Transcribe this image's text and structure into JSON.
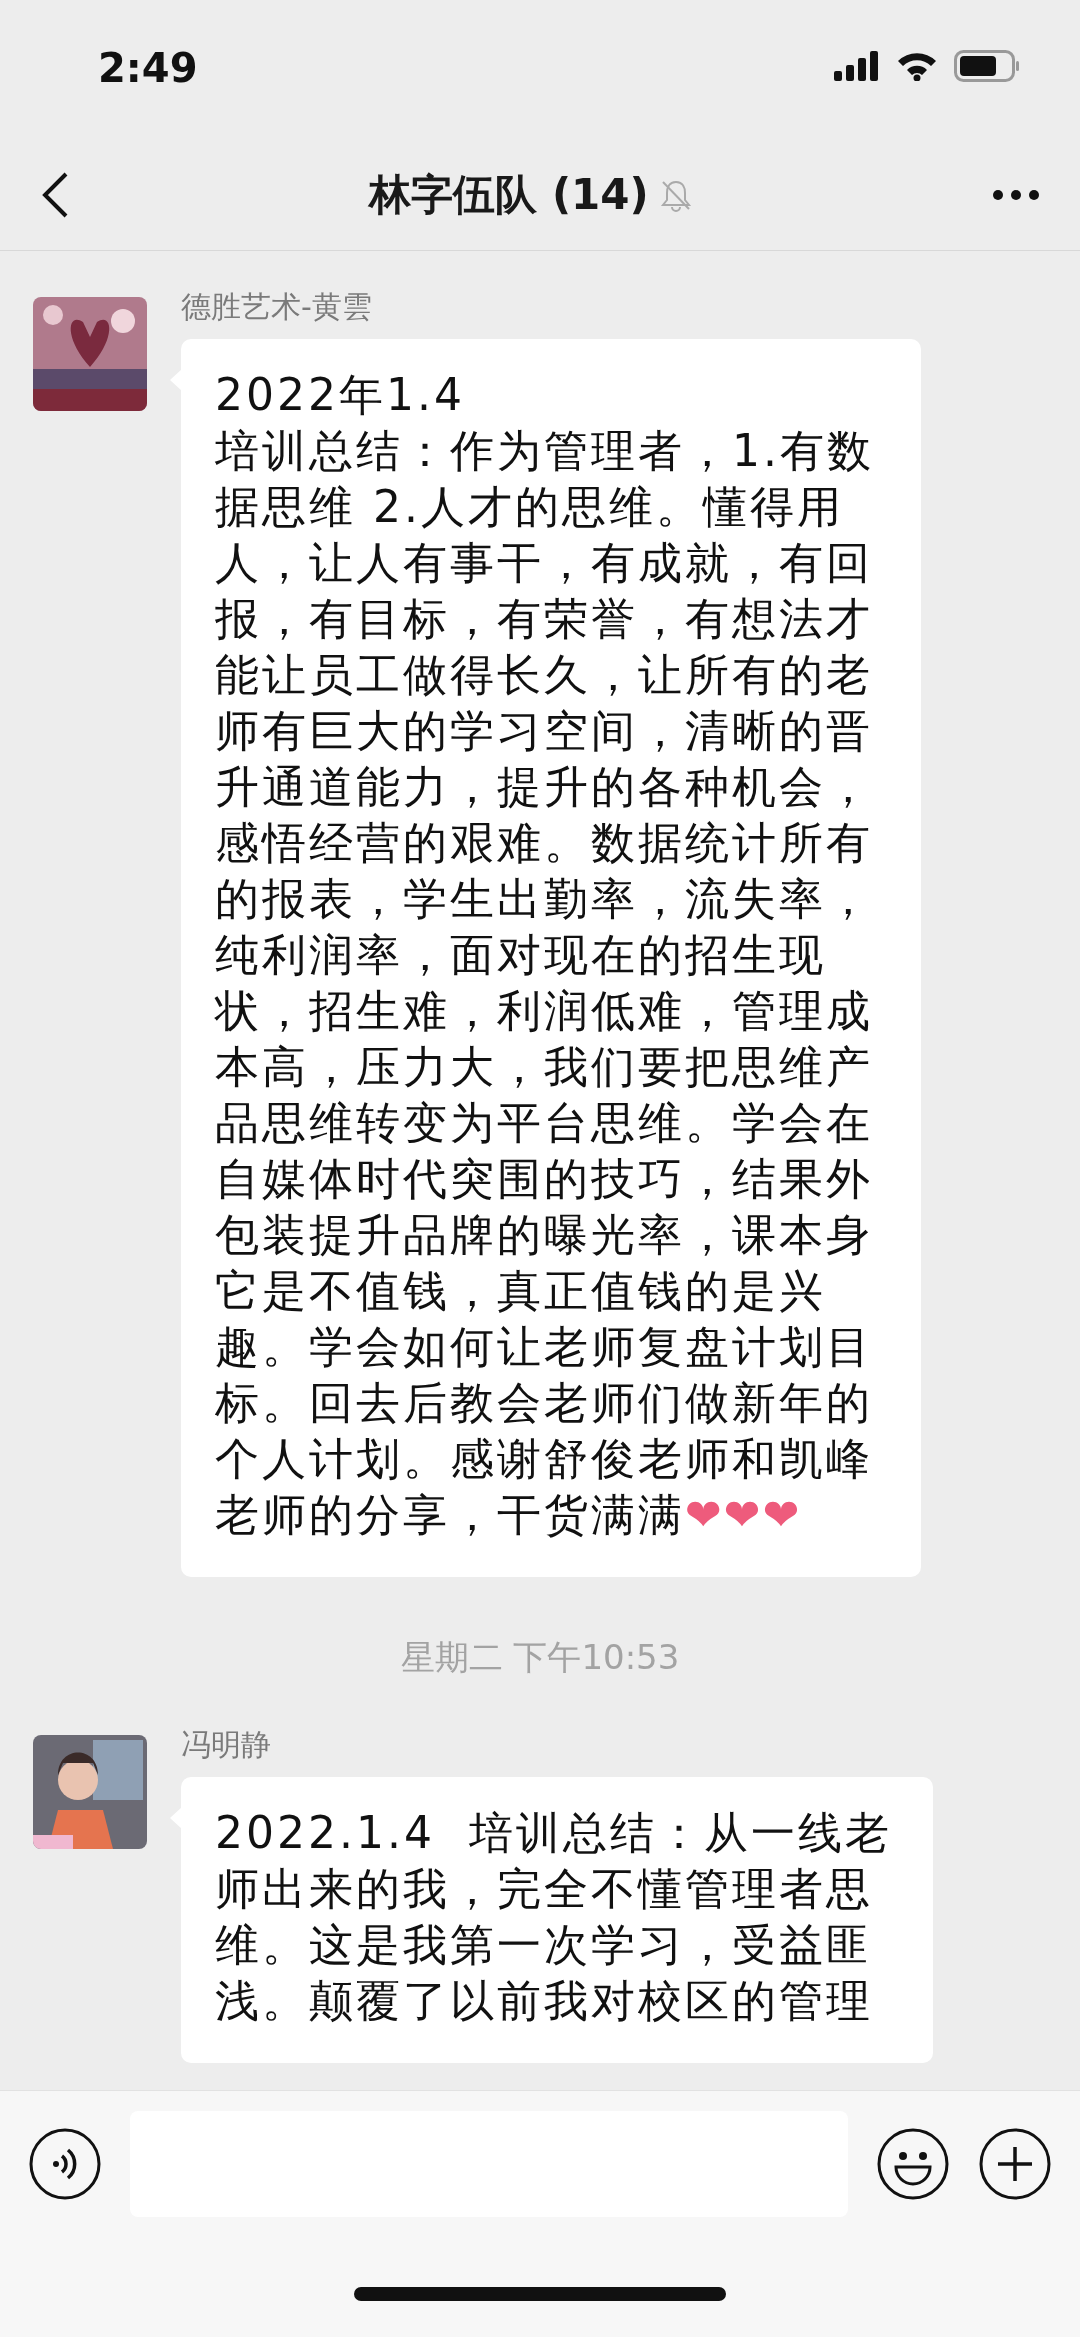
{
  "status_bar": {
    "time": "2:49"
  },
  "nav": {
    "title": "林字伍队 (14)",
    "muted": true
  },
  "messages": [
    {
      "kind": "message",
      "sender": "德胜艺术-黄雲",
      "text": "2022年1.4\n培训总结：作为管理者，1.有数据思维 2.人才的思维。懂得用人，让人有事干，有成就，有回报，有目标，有荣誉，有想法才能让员工做得长久，让所有的老师有巨大的学习空间，清晰的晋升通道能力，提升的各种机会，感悟经营的艰难。数据统计所有的报表，学生出勤率，流失率，纯利润率，面对现在的招生现状，招生难，利润低难，管理成本高，压力大，我们要把思维产品思维转变为平台思维。学会在自媒体时代突围的技巧，结果外包装提升品牌的曝光率，课本身它是不值钱，真正值钱的是兴趣。学会如何让老师复盘计划目标。回去后教会老师们做新年的个人计划。感谢舒俊老师和凯峰老师的分享，干货满满",
      "emoji": "❤❤❤"
    },
    {
      "kind": "time",
      "text": "星期二 下午10:53"
    },
    {
      "kind": "message",
      "sender": "冯明静",
      "text": "2022.1.4  培训总结：从一线老师出来的我，完全不懂管理者思维。这是我第一次学习，受益匪浅。颠覆了以前我对校区的管理"
    }
  ]
}
